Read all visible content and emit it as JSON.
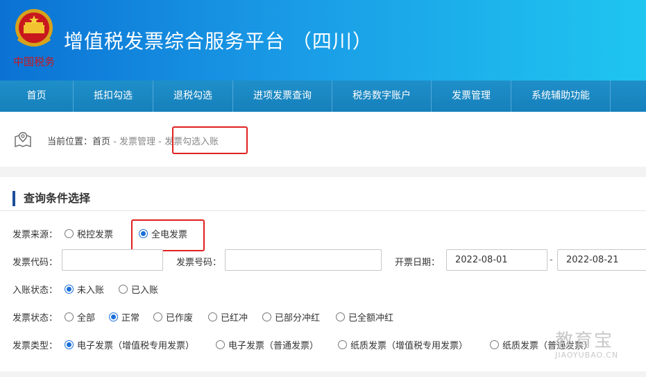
{
  "header": {
    "title": "增值税发票综合服务平台 （四川）",
    "emblem_text": "中国税务"
  },
  "nav": {
    "items": [
      {
        "label": "首页"
      },
      {
        "label": "抵扣勾选"
      },
      {
        "label": "退税勾选"
      },
      {
        "label": "进项发票查询"
      },
      {
        "label": "税务数字账户"
      },
      {
        "label": "发票管理"
      },
      {
        "label": "系统辅助功能"
      }
    ]
  },
  "breadcrumb": {
    "prefix": "当前位置：",
    "home": "首页",
    "sep1": " - ",
    "section": "发票管理",
    "sep2": " - ",
    "current": "发票勾选入账"
  },
  "panel": {
    "title": "查询条件选择",
    "source": {
      "label": "发票来源：",
      "options": [
        "税控发票",
        "全电发票"
      ],
      "selected": "全电发票"
    },
    "invoice_code": {
      "label": "发票代码：",
      "value": ""
    },
    "invoice_number": {
      "label": "发票号码：",
      "value": ""
    },
    "issue_date": {
      "label": "开票日期：",
      "from": "2022-08-01",
      "sep": "-",
      "to": "2022-08-21"
    },
    "account_status": {
      "label": "入账状态：",
      "options": [
        "未入账",
        "已入账"
      ],
      "selected": "未入账"
    },
    "invoice_status": {
      "label": "发票状态：",
      "options": [
        "全部",
        "正常",
        "已作废",
        "已红冲",
        "已部分冲红",
        "已全额冲红"
      ],
      "selected": "正常"
    },
    "invoice_type": {
      "label": "发票类型：",
      "options": [
        "电子发票（增值税专用发票）",
        "电子发票（普通发票）",
        "纸质发票（增值税专用发票）",
        "纸质发票（普通发票）"
      ],
      "selected": "电子发票（增值税专用发票）"
    }
  },
  "watermark": {
    "text": "教育宝",
    "sub": "JIAOYUBAO.CN"
  },
  "colors": {
    "accent": "#1a6fd8",
    "highlight": "#e02020",
    "nav": "#1680bb"
  }
}
